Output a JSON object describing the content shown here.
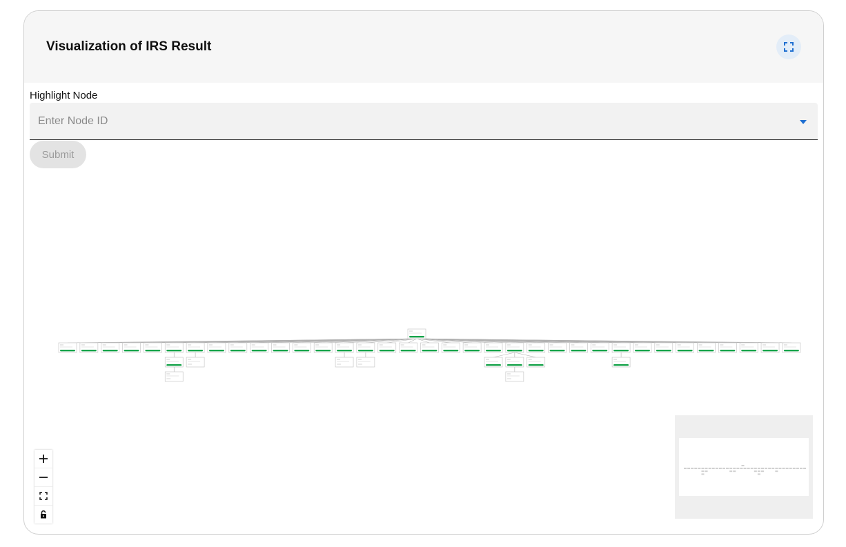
{
  "card": {
    "title": "Visualization of IRS Result"
  },
  "form": {
    "label": "Highlight Node",
    "placeholder": "Enter Node ID",
    "value": "",
    "submit_label": "Submit"
  },
  "graph": {
    "colors": {
      "badge": "#16a34a",
      "edge": "#b0b0b0",
      "node_border": "#c8c8c8"
    },
    "root": {
      "status": "complete"
    },
    "nodes": [
      {
        "status": "complete",
        "children": []
      },
      {
        "status": "complete",
        "children": []
      },
      {
        "status": "complete",
        "children": []
      },
      {
        "status": "complete",
        "children": []
      },
      {
        "status": "complete",
        "children": []
      },
      {
        "status": "complete",
        "children": [
          {
            "status": "complete",
            "children": [
              {
                "status": "none",
                "children": []
              }
            ]
          }
        ]
      },
      {
        "status": "complete",
        "children": [
          {
            "status": "none",
            "children": []
          }
        ]
      },
      {
        "status": "complete",
        "children": []
      },
      {
        "status": "complete",
        "children": []
      },
      {
        "status": "complete",
        "children": []
      },
      {
        "status": "complete",
        "children": []
      },
      {
        "status": "complete",
        "children": []
      },
      {
        "status": "complete",
        "children": []
      },
      {
        "status": "complete",
        "children": [
          {
            "status": "none",
            "children": []
          }
        ]
      },
      {
        "status": "complete",
        "children": [
          {
            "status": "none",
            "children": []
          }
        ]
      },
      {
        "status": "complete",
        "children": []
      },
      {
        "status": "complete",
        "children": []
      },
      {
        "status": "complete",
        "children": []
      },
      {
        "status": "complete",
        "children": []
      },
      {
        "status": "complete",
        "children": []
      },
      {
        "status": "complete",
        "children": []
      },
      {
        "status": "complete",
        "children": [
          {
            "status": "complete",
            "children": []
          },
          {
            "status": "complete",
            "children": [
              {
                "status": "none",
                "children": []
              }
            ]
          },
          {
            "status": "complete",
            "children": []
          }
        ]
      },
      {
        "status": "complete",
        "children": []
      },
      {
        "status": "complete",
        "children": []
      },
      {
        "status": "complete",
        "children": []
      },
      {
        "status": "complete",
        "children": []
      },
      {
        "status": "complete",
        "children": [
          {
            "status": "complete",
            "children": []
          }
        ]
      },
      {
        "status": "complete",
        "children": []
      },
      {
        "status": "complete",
        "children": []
      },
      {
        "status": "complete",
        "children": []
      },
      {
        "status": "complete",
        "children": []
      },
      {
        "status": "complete",
        "children": []
      },
      {
        "status": "complete",
        "children": []
      },
      {
        "status": "complete",
        "children": []
      },
      {
        "status": "complete",
        "children": []
      }
    ]
  },
  "controls": {
    "icons": [
      "zoom-in-icon",
      "zoom-out-icon",
      "fit-view-icon",
      "lock-icon"
    ]
  },
  "minimap": {
    "present": true
  }
}
